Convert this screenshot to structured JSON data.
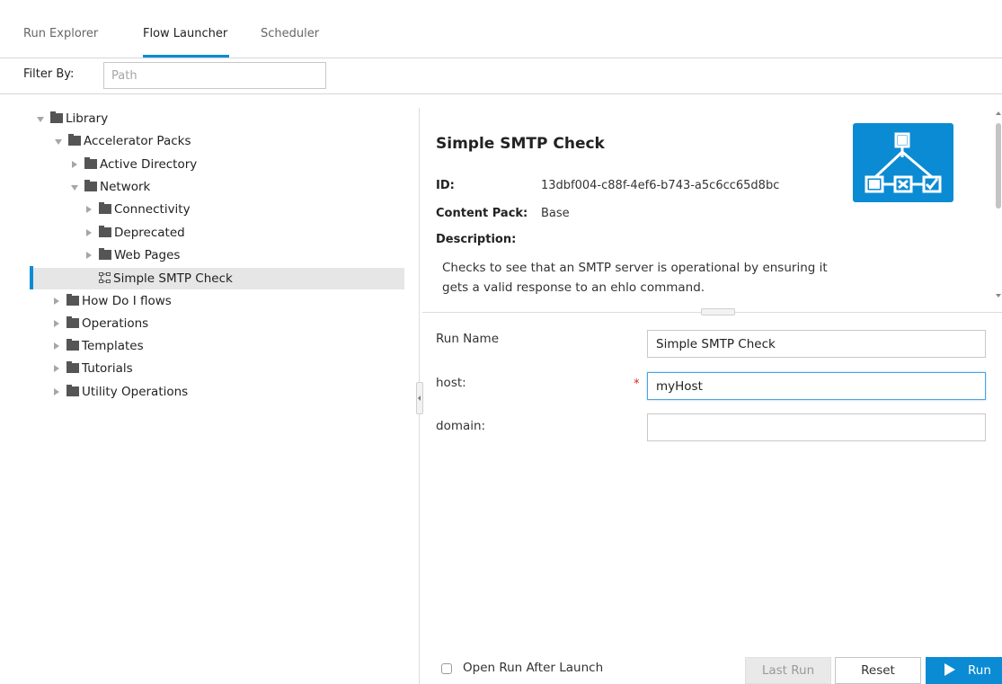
{
  "tabs": [
    {
      "label": "Run Explorer",
      "active": false
    },
    {
      "label": "Flow Launcher",
      "active": true
    },
    {
      "label": "Scheduler",
      "active": false
    }
  ],
  "filter": {
    "label": "Filter By:",
    "placeholder": "Path"
  },
  "tree": [
    {
      "label": "Library",
      "expanded": true,
      "icon": "folder-icon"
    },
    {
      "label": "Accelerator Packs",
      "expanded": true,
      "icon": "folder-icon"
    },
    {
      "label": "Active Directory",
      "expanded": false,
      "icon": "folder-icon"
    },
    {
      "label": "Network",
      "expanded": true,
      "icon": "folder-icon"
    },
    {
      "label": "Connectivity",
      "expanded": false,
      "icon": "folder-icon"
    },
    {
      "label": "Deprecated",
      "expanded": false,
      "icon": "folder-icon"
    },
    {
      "label": "Web Pages",
      "expanded": false,
      "icon": "folder-icon"
    },
    {
      "label": "Simple SMTP Check",
      "selected": true,
      "icon": "flow-icon"
    },
    {
      "label": "How Do I flows",
      "expanded": false,
      "icon": "folder-icon"
    },
    {
      "label": "Operations",
      "expanded": false,
      "icon": "folder-icon"
    },
    {
      "label": "Templates",
      "expanded": false,
      "icon": "folder-icon"
    },
    {
      "label": "Tutorials",
      "expanded": false,
      "icon": "folder-icon"
    },
    {
      "label": "Utility Operations",
      "expanded": false,
      "icon": "folder-icon"
    }
  ],
  "details": {
    "title": "Simple SMTP Check",
    "id_label": "ID:",
    "id_value": "13dbf004-c88f-4ef6-b743-a5c6cc65d8bc",
    "content_pack_label": "Content Pack:",
    "content_pack_value": "Base",
    "description_label": "Description:",
    "description": "Checks to see that an SMTP server is operational by ensuring it gets a valid response to an ehlo command.",
    "logo_icon": "flow-diagram-icon"
  },
  "form": {
    "run_name_label": "Run Name",
    "run_name_value": "Simple SMTP Check",
    "host_label": "host:",
    "host_required": "*",
    "host_value": "myHost",
    "domain_label": "domain:",
    "domain_value": ""
  },
  "footer": {
    "open_run_label": "Open Run After Launch",
    "last_run_label": "Last Run",
    "reset_label": "Reset",
    "run_label": "Run"
  },
  "colors": {
    "accent": "#0b8bd3",
    "required": "#d9261c"
  }
}
